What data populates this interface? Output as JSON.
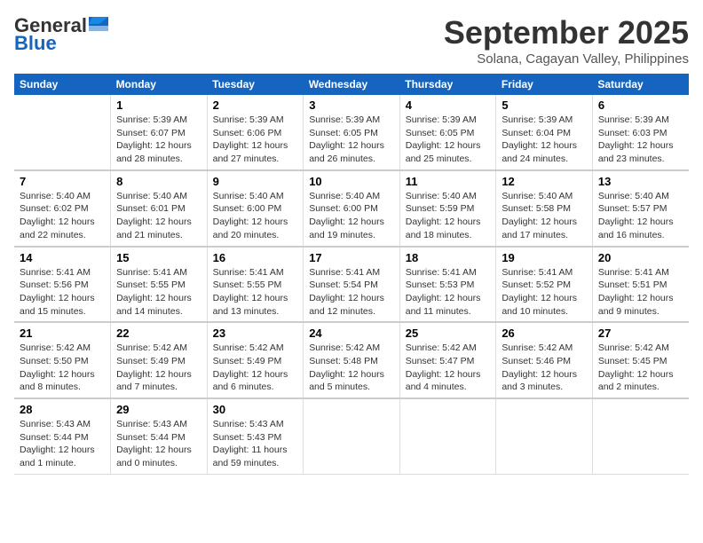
{
  "header": {
    "logo_general": "General",
    "logo_blue": "Blue",
    "month": "September 2025",
    "location": "Solana, Cagayan Valley, Philippines"
  },
  "weekdays": [
    "Sunday",
    "Monday",
    "Tuesday",
    "Wednesday",
    "Thursday",
    "Friday",
    "Saturday"
  ],
  "weeks": [
    [
      {
        "day": "",
        "content": ""
      },
      {
        "day": "1",
        "content": "Sunrise: 5:39 AM\nSunset: 6:07 PM\nDaylight: 12 hours\nand 28 minutes."
      },
      {
        "day": "2",
        "content": "Sunrise: 5:39 AM\nSunset: 6:06 PM\nDaylight: 12 hours\nand 27 minutes."
      },
      {
        "day": "3",
        "content": "Sunrise: 5:39 AM\nSunset: 6:05 PM\nDaylight: 12 hours\nand 26 minutes."
      },
      {
        "day": "4",
        "content": "Sunrise: 5:39 AM\nSunset: 6:05 PM\nDaylight: 12 hours\nand 25 minutes."
      },
      {
        "day": "5",
        "content": "Sunrise: 5:39 AM\nSunset: 6:04 PM\nDaylight: 12 hours\nand 24 minutes."
      },
      {
        "day": "6",
        "content": "Sunrise: 5:39 AM\nSunset: 6:03 PM\nDaylight: 12 hours\nand 23 minutes."
      }
    ],
    [
      {
        "day": "7",
        "content": "Sunrise: 5:40 AM\nSunset: 6:02 PM\nDaylight: 12 hours\nand 22 minutes."
      },
      {
        "day": "8",
        "content": "Sunrise: 5:40 AM\nSunset: 6:01 PM\nDaylight: 12 hours\nand 21 minutes."
      },
      {
        "day": "9",
        "content": "Sunrise: 5:40 AM\nSunset: 6:00 PM\nDaylight: 12 hours\nand 20 minutes."
      },
      {
        "day": "10",
        "content": "Sunrise: 5:40 AM\nSunset: 6:00 PM\nDaylight: 12 hours\nand 19 minutes."
      },
      {
        "day": "11",
        "content": "Sunrise: 5:40 AM\nSunset: 5:59 PM\nDaylight: 12 hours\nand 18 minutes."
      },
      {
        "day": "12",
        "content": "Sunrise: 5:40 AM\nSunset: 5:58 PM\nDaylight: 12 hours\nand 17 minutes."
      },
      {
        "day": "13",
        "content": "Sunrise: 5:40 AM\nSunset: 5:57 PM\nDaylight: 12 hours\nand 16 minutes."
      }
    ],
    [
      {
        "day": "14",
        "content": "Sunrise: 5:41 AM\nSunset: 5:56 PM\nDaylight: 12 hours\nand 15 minutes."
      },
      {
        "day": "15",
        "content": "Sunrise: 5:41 AM\nSunset: 5:55 PM\nDaylight: 12 hours\nand 14 minutes."
      },
      {
        "day": "16",
        "content": "Sunrise: 5:41 AM\nSunset: 5:55 PM\nDaylight: 12 hours\nand 13 minutes."
      },
      {
        "day": "17",
        "content": "Sunrise: 5:41 AM\nSunset: 5:54 PM\nDaylight: 12 hours\nand 12 minutes."
      },
      {
        "day": "18",
        "content": "Sunrise: 5:41 AM\nSunset: 5:53 PM\nDaylight: 12 hours\nand 11 minutes."
      },
      {
        "day": "19",
        "content": "Sunrise: 5:41 AM\nSunset: 5:52 PM\nDaylight: 12 hours\nand 10 minutes."
      },
      {
        "day": "20",
        "content": "Sunrise: 5:41 AM\nSunset: 5:51 PM\nDaylight: 12 hours\nand 9 minutes."
      }
    ],
    [
      {
        "day": "21",
        "content": "Sunrise: 5:42 AM\nSunset: 5:50 PM\nDaylight: 12 hours\nand 8 minutes."
      },
      {
        "day": "22",
        "content": "Sunrise: 5:42 AM\nSunset: 5:49 PM\nDaylight: 12 hours\nand 7 minutes."
      },
      {
        "day": "23",
        "content": "Sunrise: 5:42 AM\nSunset: 5:49 PM\nDaylight: 12 hours\nand 6 minutes."
      },
      {
        "day": "24",
        "content": "Sunrise: 5:42 AM\nSunset: 5:48 PM\nDaylight: 12 hours\nand 5 minutes."
      },
      {
        "day": "25",
        "content": "Sunrise: 5:42 AM\nSunset: 5:47 PM\nDaylight: 12 hours\nand 4 minutes."
      },
      {
        "day": "26",
        "content": "Sunrise: 5:42 AM\nSunset: 5:46 PM\nDaylight: 12 hours\nand 3 minutes."
      },
      {
        "day": "27",
        "content": "Sunrise: 5:42 AM\nSunset: 5:45 PM\nDaylight: 12 hours\nand 2 minutes."
      }
    ],
    [
      {
        "day": "28",
        "content": "Sunrise: 5:43 AM\nSunset: 5:44 PM\nDaylight: 12 hours\nand 1 minute."
      },
      {
        "day": "29",
        "content": "Sunrise: 5:43 AM\nSunset: 5:44 PM\nDaylight: 12 hours\nand 0 minutes."
      },
      {
        "day": "30",
        "content": "Sunrise: 5:43 AM\nSunset: 5:43 PM\nDaylight: 11 hours\nand 59 minutes."
      },
      {
        "day": "",
        "content": ""
      },
      {
        "day": "",
        "content": ""
      },
      {
        "day": "",
        "content": ""
      },
      {
        "day": "",
        "content": ""
      }
    ]
  ]
}
